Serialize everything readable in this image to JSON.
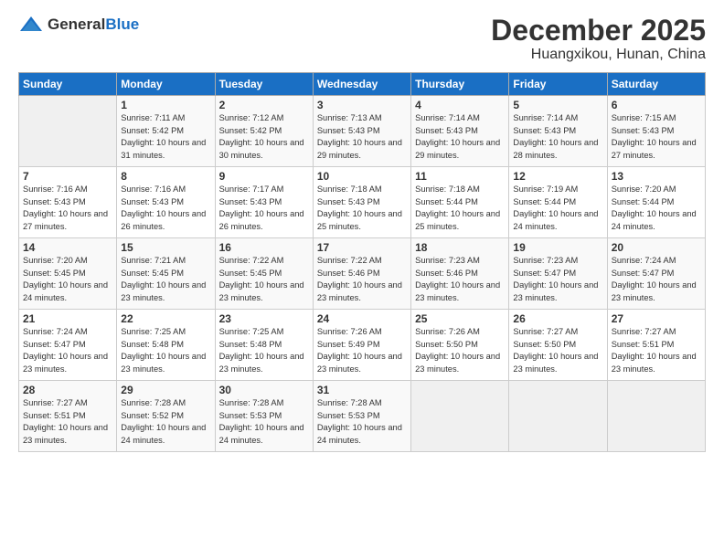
{
  "logo": {
    "general": "General",
    "blue": "Blue"
  },
  "title": "December 2025",
  "location": "Huangxikou, Hunan, China",
  "days_of_week": [
    "Sunday",
    "Monday",
    "Tuesday",
    "Wednesday",
    "Thursday",
    "Friday",
    "Saturday"
  ],
  "weeks": [
    [
      {
        "day": "",
        "sunrise": "",
        "sunset": "",
        "daylight": ""
      },
      {
        "day": "1",
        "sunrise": "Sunrise: 7:11 AM",
        "sunset": "Sunset: 5:42 PM",
        "daylight": "Daylight: 10 hours and 31 minutes."
      },
      {
        "day": "2",
        "sunrise": "Sunrise: 7:12 AM",
        "sunset": "Sunset: 5:42 PM",
        "daylight": "Daylight: 10 hours and 30 minutes."
      },
      {
        "day": "3",
        "sunrise": "Sunrise: 7:13 AM",
        "sunset": "Sunset: 5:43 PM",
        "daylight": "Daylight: 10 hours and 29 minutes."
      },
      {
        "day": "4",
        "sunrise": "Sunrise: 7:14 AM",
        "sunset": "Sunset: 5:43 PM",
        "daylight": "Daylight: 10 hours and 29 minutes."
      },
      {
        "day": "5",
        "sunrise": "Sunrise: 7:14 AM",
        "sunset": "Sunset: 5:43 PM",
        "daylight": "Daylight: 10 hours and 28 minutes."
      },
      {
        "day": "6",
        "sunrise": "Sunrise: 7:15 AM",
        "sunset": "Sunset: 5:43 PM",
        "daylight": "Daylight: 10 hours and 27 minutes."
      }
    ],
    [
      {
        "day": "7",
        "sunrise": "Sunrise: 7:16 AM",
        "sunset": "Sunset: 5:43 PM",
        "daylight": "Daylight: 10 hours and 27 minutes."
      },
      {
        "day": "8",
        "sunrise": "Sunrise: 7:16 AM",
        "sunset": "Sunset: 5:43 PM",
        "daylight": "Daylight: 10 hours and 26 minutes."
      },
      {
        "day": "9",
        "sunrise": "Sunrise: 7:17 AM",
        "sunset": "Sunset: 5:43 PM",
        "daylight": "Daylight: 10 hours and 26 minutes."
      },
      {
        "day": "10",
        "sunrise": "Sunrise: 7:18 AM",
        "sunset": "Sunset: 5:43 PM",
        "daylight": "Daylight: 10 hours and 25 minutes."
      },
      {
        "day": "11",
        "sunrise": "Sunrise: 7:18 AM",
        "sunset": "Sunset: 5:44 PM",
        "daylight": "Daylight: 10 hours and 25 minutes."
      },
      {
        "day": "12",
        "sunrise": "Sunrise: 7:19 AM",
        "sunset": "Sunset: 5:44 PM",
        "daylight": "Daylight: 10 hours and 24 minutes."
      },
      {
        "day": "13",
        "sunrise": "Sunrise: 7:20 AM",
        "sunset": "Sunset: 5:44 PM",
        "daylight": "Daylight: 10 hours and 24 minutes."
      }
    ],
    [
      {
        "day": "14",
        "sunrise": "Sunrise: 7:20 AM",
        "sunset": "Sunset: 5:45 PM",
        "daylight": "Daylight: 10 hours and 24 minutes."
      },
      {
        "day": "15",
        "sunrise": "Sunrise: 7:21 AM",
        "sunset": "Sunset: 5:45 PM",
        "daylight": "Daylight: 10 hours and 23 minutes."
      },
      {
        "day": "16",
        "sunrise": "Sunrise: 7:22 AM",
        "sunset": "Sunset: 5:45 PM",
        "daylight": "Daylight: 10 hours and 23 minutes."
      },
      {
        "day": "17",
        "sunrise": "Sunrise: 7:22 AM",
        "sunset": "Sunset: 5:46 PM",
        "daylight": "Daylight: 10 hours and 23 minutes."
      },
      {
        "day": "18",
        "sunrise": "Sunrise: 7:23 AM",
        "sunset": "Sunset: 5:46 PM",
        "daylight": "Daylight: 10 hours and 23 minutes."
      },
      {
        "day": "19",
        "sunrise": "Sunrise: 7:23 AM",
        "sunset": "Sunset: 5:47 PM",
        "daylight": "Daylight: 10 hours and 23 minutes."
      },
      {
        "day": "20",
        "sunrise": "Sunrise: 7:24 AM",
        "sunset": "Sunset: 5:47 PM",
        "daylight": "Daylight: 10 hours and 23 minutes."
      }
    ],
    [
      {
        "day": "21",
        "sunrise": "Sunrise: 7:24 AM",
        "sunset": "Sunset: 5:47 PM",
        "daylight": "Daylight: 10 hours and 23 minutes."
      },
      {
        "day": "22",
        "sunrise": "Sunrise: 7:25 AM",
        "sunset": "Sunset: 5:48 PM",
        "daylight": "Daylight: 10 hours and 23 minutes."
      },
      {
        "day": "23",
        "sunrise": "Sunrise: 7:25 AM",
        "sunset": "Sunset: 5:48 PM",
        "daylight": "Daylight: 10 hours and 23 minutes."
      },
      {
        "day": "24",
        "sunrise": "Sunrise: 7:26 AM",
        "sunset": "Sunset: 5:49 PM",
        "daylight": "Daylight: 10 hours and 23 minutes."
      },
      {
        "day": "25",
        "sunrise": "Sunrise: 7:26 AM",
        "sunset": "Sunset: 5:50 PM",
        "daylight": "Daylight: 10 hours and 23 minutes."
      },
      {
        "day": "26",
        "sunrise": "Sunrise: 7:27 AM",
        "sunset": "Sunset: 5:50 PM",
        "daylight": "Daylight: 10 hours and 23 minutes."
      },
      {
        "day": "27",
        "sunrise": "Sunrise: 7:27 AM",
        "sunset": "Sunset: 5:51 PM",
        "daylight": "Daylight: 10 hours and 23 minutes."
      }
    ],
    [
      {
        "day": "28",
        "sunrise": "Sunrise: 7:27 AM",
        "sunset": "Sunset: 5:51 PM",
        "daylight": "Daylight: 10 hours and 23 minutes."
      },
      {
        "day": "29",
        "sunrise": "Sunrise: 7:28 AM",
        "sunset": "Sunset: 5:52 PM",
        "daylight": "Daylight: 10 hours and 24 minutes."
      },
      {
        "day": "30",
        "sunrise": "Sunrise: 7:28 AM",
        "sunset": "Sunset: 5:53 PM",
        "daylight": "Daylight: 10 hours and 24 minutes."
      },
      {
        "day": "31",
        "sunrise": "Sunrise: 7:28 AM",
        "sunset": "Sunset: 5:53 PM",
        "daylight": "Daylight: 10 hours and 24 minutes."
      },
      {
        "day": "",
        "sunrise": "",
        "sunset": "",
        "daylight": ""
      },
      {
        "day": "",
        "sunrise": "",
        "sunset": "",
        "daylight": ""
      },
      {
        "day": "",
        "sunrise": "",
        "sunset": "",
        "daylight": ""
      }
    ]
  ]
}
